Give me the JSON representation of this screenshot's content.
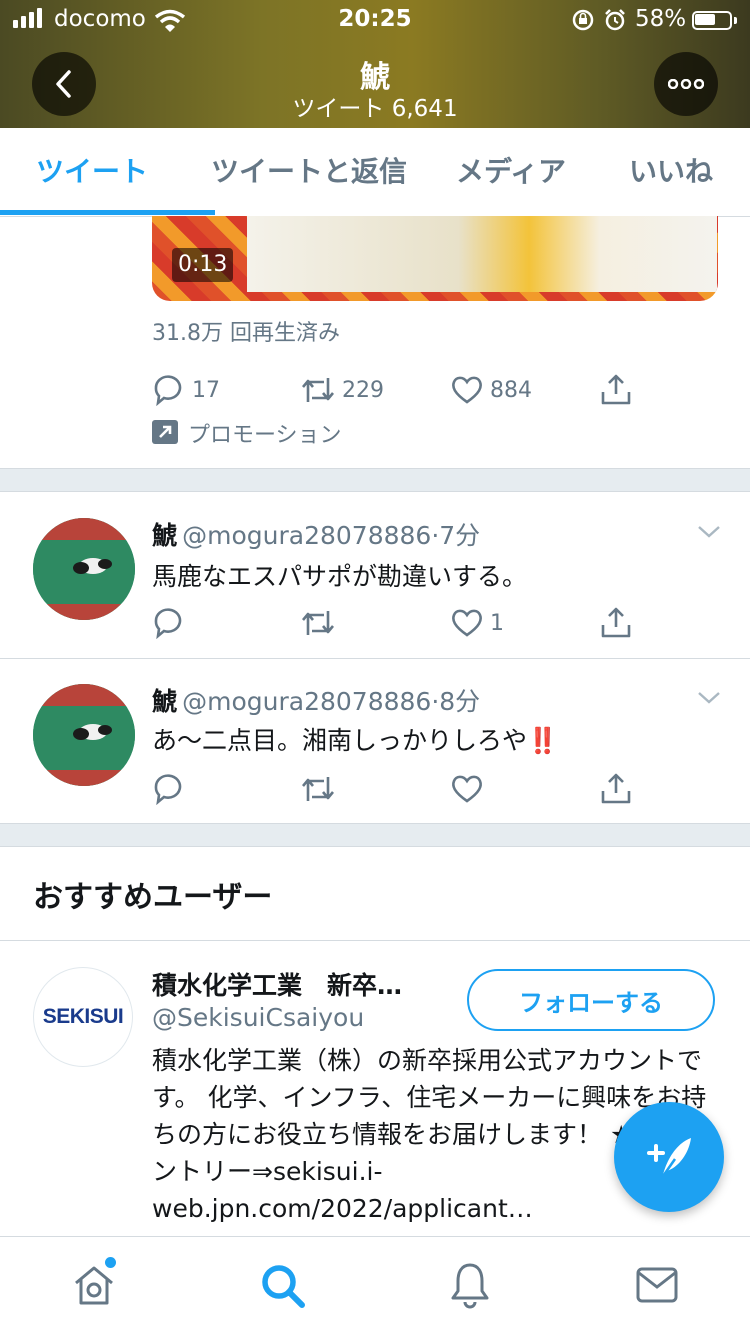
{
  "status_bar": {
    "carrier": "docomo",
    "time": "20:25",
    "battery_percent": "58%",
    "battery_level": 0.58
  },
  "header": {
    "name": "鯱",
    "tweet_count": "ツイート 6,641"
  },
  "tabs": [
    "ツイート",
    "ツイートと返信",
    "メディア",
    "いいね"
  ],
  "promo_tweet": {
    "video_duration": "0:13",
    "views": "31.8万 回再生済み",
    "replies": "17",
    "retweets": "229",
    "likes": "884",
    "promotion_label": "プロモーション"
  },
  "tweets": [
    {
      "name": "鯱",
      "handle": "@mogura28078886",
      "time": "7分",
      "text": "馬鹿なエスパサポが勘違いする。",
      "likes": "1"
    },
    {
      "name": "鯱",
      "handle": "@mogura28078886",
      "time": "8分",
      "text": "あ〜二点目。湘南しっかりしろや",
      "emoji": "‼️",
      "likes": ""
    }
  ],
  "suggested": {
    "title": "おすすめユーザー",
    "user": {
      "name": "積水化学工業　新卒…",
      "handle": "@SekisuiCsaiyou",
      "avatar_text": "SEKISUI",
      "follow_label": "フォローする",
      "bio": "積水化学工業（株）の新卒採用公式アカウントです。 化学、インフラ、住宅メーカーに興味をお持ちの方にお役立ち情報をお届けします！ ★22卒エントリー⇒sekisui.i-web.jpn.com/2022/applicant…"
    }
  },
  "colors": {
    "accent": "#1da1f2",
    "text": "#14171a",
    "secondary": "#657786",
    "separator": "#e6ecf0",
    "sekisui_blue": "#1a3b8c"
  }
}
